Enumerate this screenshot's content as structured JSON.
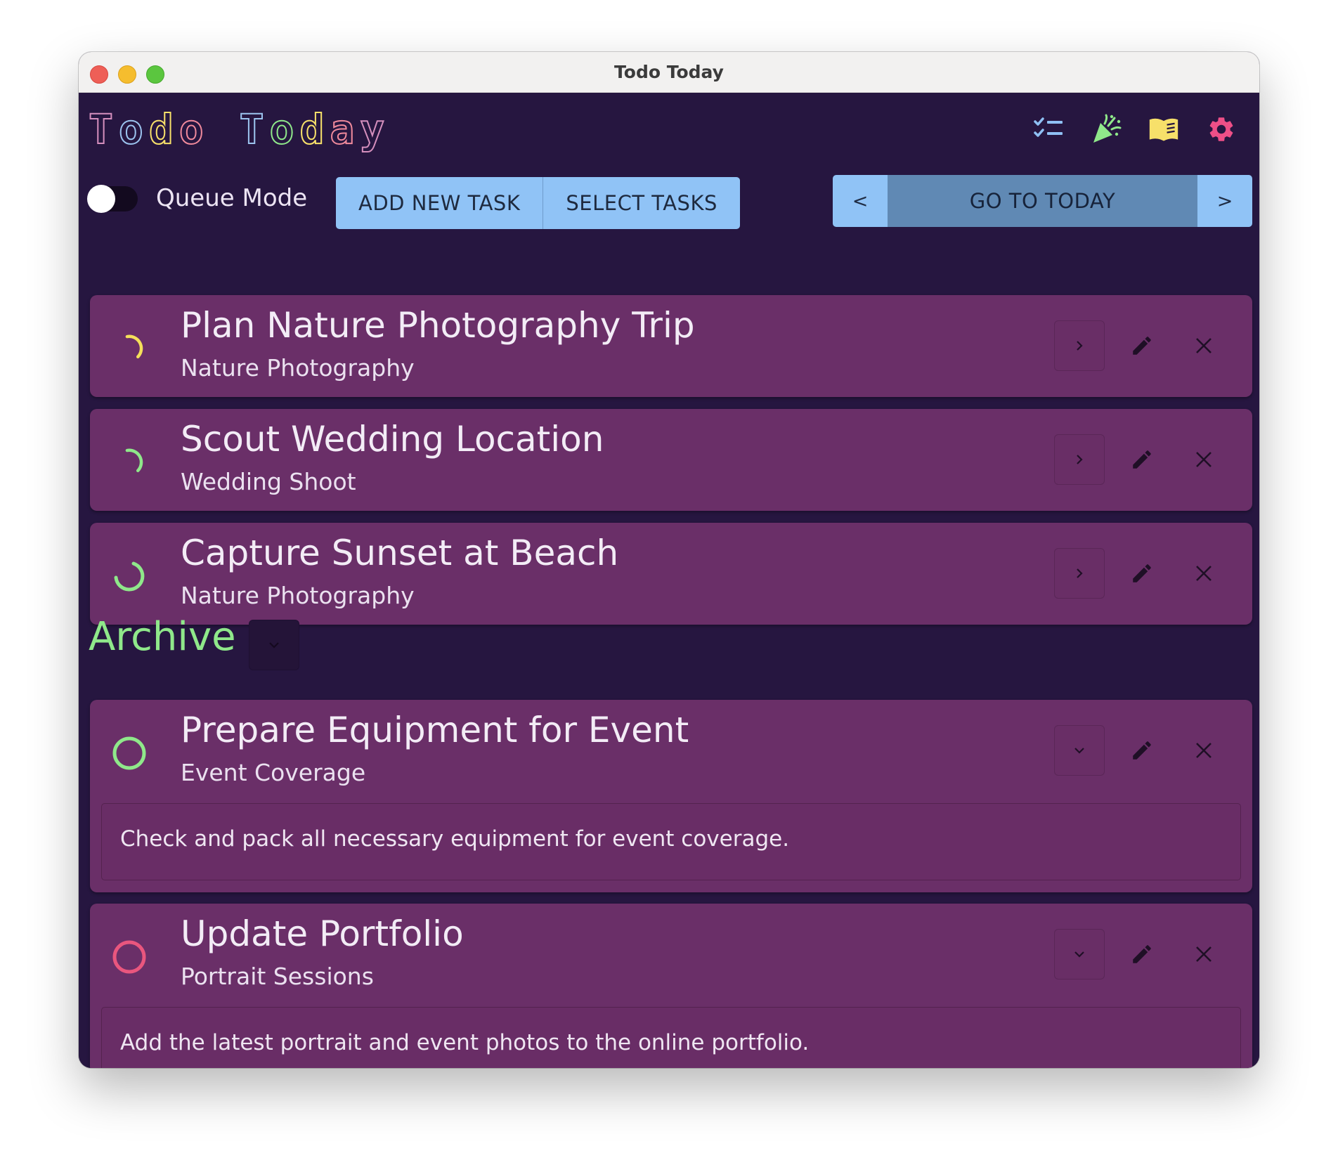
{
  "window": {
    "title": "Todo Today"
  },
  "header": {
    "logo": [
      "T",
      "o",
      "d",
      "o",
      " ",
      "T",
      "o",
      "d",
      "a",
      "y"
    ],
    "logo_colors": [
      "#d58fbd",
      "#9cc4ef",
      "#f7e06a",
      "#f08a9c",
      "#d58fbd",
      "#9cc4ef",
      "#8fe88a",
      "#f7e06a",
      "#f08a9c",
      "#d58fbd"
    ],
    "icons": [
      "checklist-icon",
      "party-popper-icon",
      "book-icon",
      "gear-icon"
    ]
  },
  "toolbar": {
    "queue_mode_label": "Queue Mode",
    "queue_mode_enabled": false,
    "add_task_label": "ADD NEW TASK",
    "select_tasks_label": "SELECT TASKS",
    "prev_label": "<",
    "today_label": "GO TO TODAY",
    "next_label": ">"
  },
  "tasks": [
    {
      "title": "Plan Nature Photography Trip",
      "project": "Nature Photography",
      "status_color": "#f4df5a",
      "progress": 0.25
    },
    {
      "title": "Scout Wedding Location",
      "project": "Wedding Shoot",
      "status_color": "#8fe88a",
      "progress": 0.25
    },
    {
      "title": "Capture Sunset at Beach",
      "project": "Nature Photography",
      "status_color": "#8fe88a",
      "progress": 0.6
    }
  ],
  "archive": {
    "label": "Archive",
    "tasks": [
      {
        "title": "Prepare Equipment for Event",
        "project": "Event Coverage",
        "description": "Check and pack all necessary equipment for event coverage.",
        "status_color": "#8fe88a"
      },
      {
        "title": "Update Portfolio",
        "project": "Portrait Sessions",
        "description": "Add the latest portrait and event photos to the online portfolio.",
        "status_color": "#e9567e"
      }
    ]
  },
  "colors": {
    "background": "#261640",
    "card": "#6a2f68",
    "accent_blue": "#90c3f6",
    "archive_green": "#8fe88a"
  }
}
